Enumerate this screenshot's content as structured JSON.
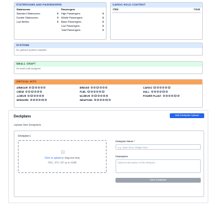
{
  "staterooms": {
    "title": "STATEROOMS AND PASSENGERS",
    "col1_header": "Staterooms",
    "col2_header": "Passengers",
    "rooms": [
      {
        "label": "Standard Staterooms:",
        "value": "0"
      },
      {
        "label": "Double Staterooms:",
        "value": "0"
      },
      {
        "label": "Low Berths:",
        "value": "0"
      }
    ],
    "passengers": [
      {
        "label": "High Passengers:",
        "value": "0"
      },
      {
        "label": "Middle Passengers:",
        "value": "0"
      },
      {
        "label": "Basic Passengers:",
        "value": "0"
      },
      {
        "label": "Low Passengers:",
        "value": "0"
      },
      {
        "label": "Total Passengers:",
        "value": "0"
      }
    ]
  },
  "cargo": {
    "title": "CARGO HOLD CONTENT",
    "col_item": "ITEM",
    "col_tons": "TONS"
  },
  "systems": {
    "title": "SYSTEMS",
    "empty": "No optional systems installed"
  },
  "small_craft": {
    "title": "SMALL CRAFT",
    "empty": "No small craft assigned"
  },
  "critical_hits": {
    "title": "CRITICAL HITS",
    "rows": [
      [
        "ARMOUR",
        "BRIDGE",
        "CARGO"
      ],
      [
        "CREW",
        "FUEL",
        "HULL"
      ],
      [
        "J-DRIVE",
        "M-DRIVE",
        "POWER PLANT"
      ],
      [
        "SENSORS",
        "WEAPONS",
        ""
      ]
    ]
  },
  "deckplans": {
    "title": "Deckplans",
    "add_button": "Add Deckplan Upload",
    "subtitle": "Upload New Deckplans",
    "card_title": "Deckplan 1",
    "upload_link": "Click to upload",
    "upload_rest": " or drag and drop",
    "upload_hint": "PNG, JPG, GIF up to 10MB",
    "name_label": "Deckplan Name *",
    "name_placeholder": "e.g., Main Deck, Bridge Deck",
    "desc_label": "Description",
    "desc_placeholder": "Optional description of this deckplan",
    "save_button": "Save Deckplan"
  }
}
